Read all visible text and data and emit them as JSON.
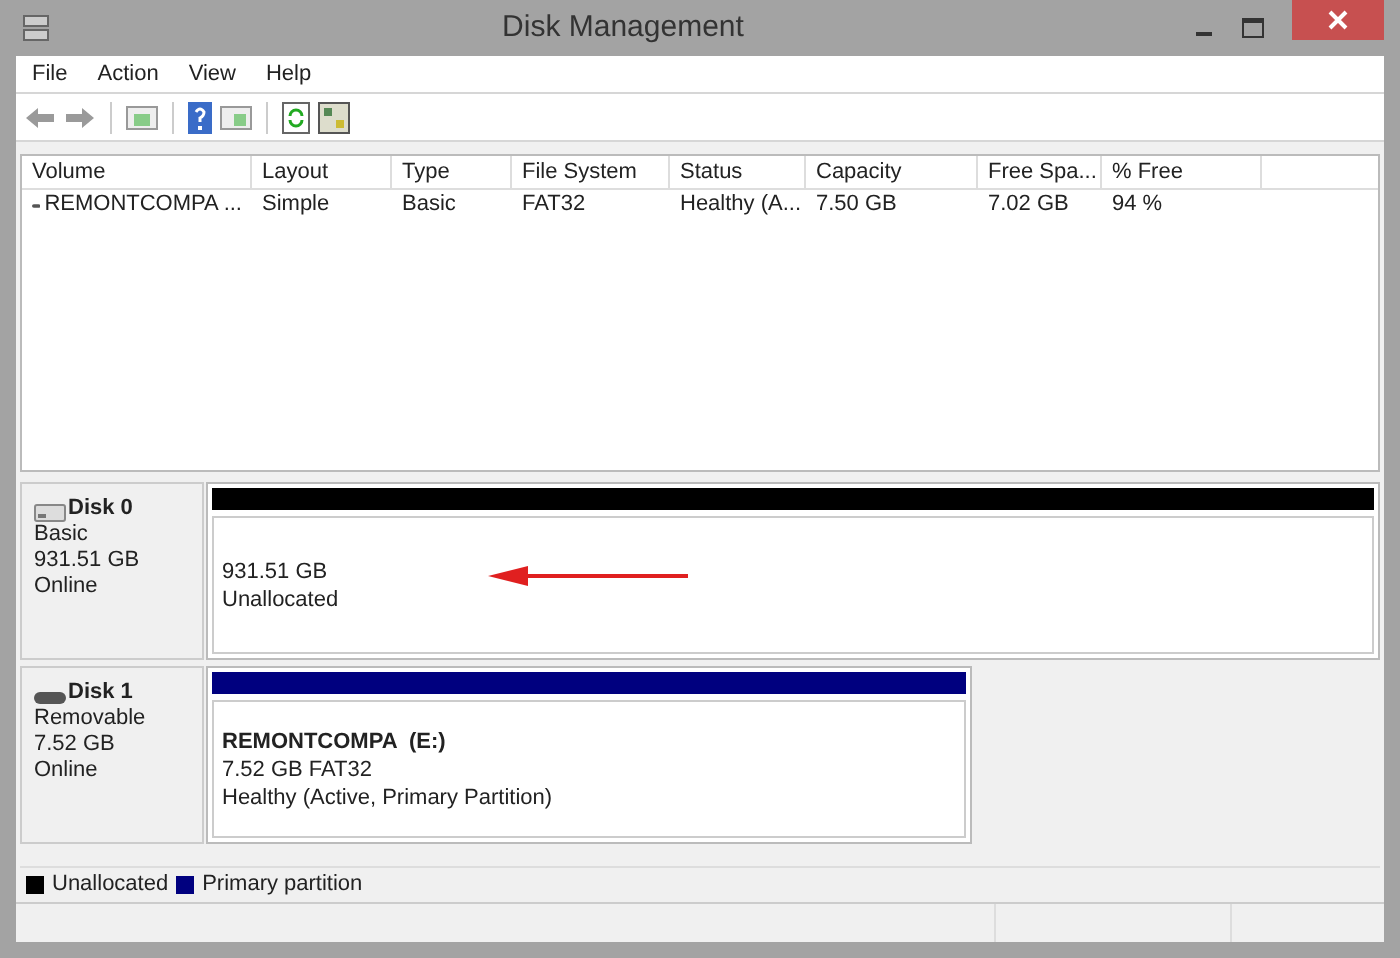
{
  "window": {
    "title": "Disk Management"
  },
  "menu": [
    "File",
    "Action",
    "View",
    "Help"
  ],
  "table": {
    "columns": [
      "Volume",
      "Layout",
      "Type",
      "File System",
      "Status",
      "Capacity",
      "Free Spa...",
      "% Free"
    ],
    "rows": [
      [
        "REMONTCOMPA ...",
        "Simple",
        "Basic",
        "FAT32",
        "Healthy (A...",
        "7.50 GB",
        "7.02 GB",
        "94 %"
      ]
    ]
  },
  "disks": [
    {
      "name": "Disk 0",
      "kind": "fixed",
      "details": [
        "Basic",
        "931.51 GB",
        "Online"
      ],
      "partitions": [
        {
          "kind": "unallocated",
          "color": "#000000",
          "lines": [
            "931.51 GB",
            "Unallocated"
          ]
        }
      ]
    },
    {
      "name": "Disk 1",
      "kind": "removable",
      "details": [
        "Removable",
        "7.52 GB",
        "Online"
      ],
      "partitions": [
        {
          "kind": "primary",
          "color": "#00007f",
          "title": "REMONTCOMPA  (E:)",
          "lines": [
            "7.52 GB FAT32",
            "Healthy (Active, Primary Partition)"
          ]
        }
      ]
    }
  ],
  "legend": [
    {
      "label": "Unallocated",
      "color": "#000000"
    },
    {
      "label": "Primary partition",
      "color": "#00007f"
    }
  ]
}
